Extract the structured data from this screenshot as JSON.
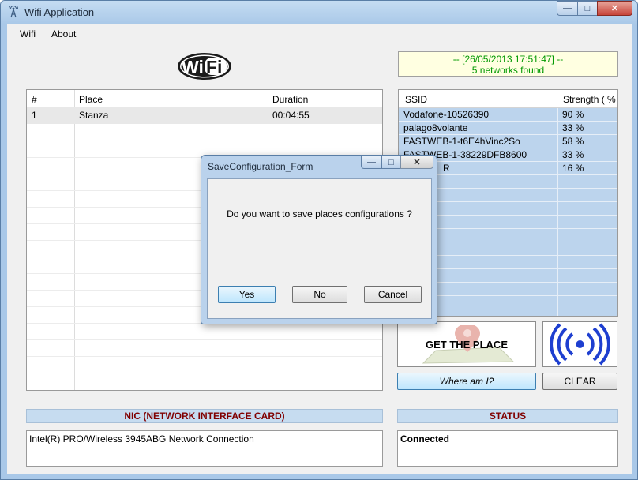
{
  "window": {
    "title": "Wifi Application",
    "controls": {
      "minimize": "—",
      "maximize": "□",
      "close": "✕"
    }
  },
  "menu": {
    "items": [
      "Wifi",
      "About"
    ]
  },
  "logo": {
    "text": "WiFi",
    "left": "Wi",
    "right": "Fi"
  },
  "places_table": {
    "columns": [
      "#",
      "Place",
      "Duration"
    ],
    "rows": [
      {
        "num": "1",
        "place": "Stanza",
        "duration": "00:04:55"
      }
    ]
  },
  "scan_status": {
    "line1": "-- [26/05/2013 17:51:47] --",
    "line2": "5 networks found"
  },
  "networks_table": {
    "columns": [
      "SSID",
      "Strength ( % )"
    ],
    "rows": [
      {
        "ssid": "Vodafone-10526390",
        "strength": "90 %"
      },
      {
        "ssid": "palago8volante",
        "strength": "33 %"
      },
      {
        "ssid": "FASTWEB-1-t6E4hVinc2So",
        "strength": "58 %"
      },
      {
        "ssid": "FASTWEB-1-38229DFB8600",
        "strength": "33 %"
      },
      {
        "ssid": "R",
        "strength": "16 %"
      }
    ]
  },
  "buttons": {
    "get_the_place": "GET THE PLACE",
    "where_am_i": "Where am I?",
    "clear": "CLEAR"
  },
  "nic": {
    "header": "NIC (NETWORK INTERFACE CARD)",
    "value": "Intel(R) PRO/Wireless 3945ABG Network Connection"
  },
  "status": {
    "header": "STATUS",
    "value": "Connected"
  },
  "dialog": {
    "title": "SaveConfiguration_Form",
    "message": "Do you want to save places configurations ?",
    "yes": "Yes",
    "no": "No",
    "cancel": "Cancel"
  },
  "colors": {
    "accent_header": "#800000",
    "scan_text": "#009900",
    "grid_blue": "#bcd4ed",
    "signal_blue": "#1e3fd0"
  }
}
